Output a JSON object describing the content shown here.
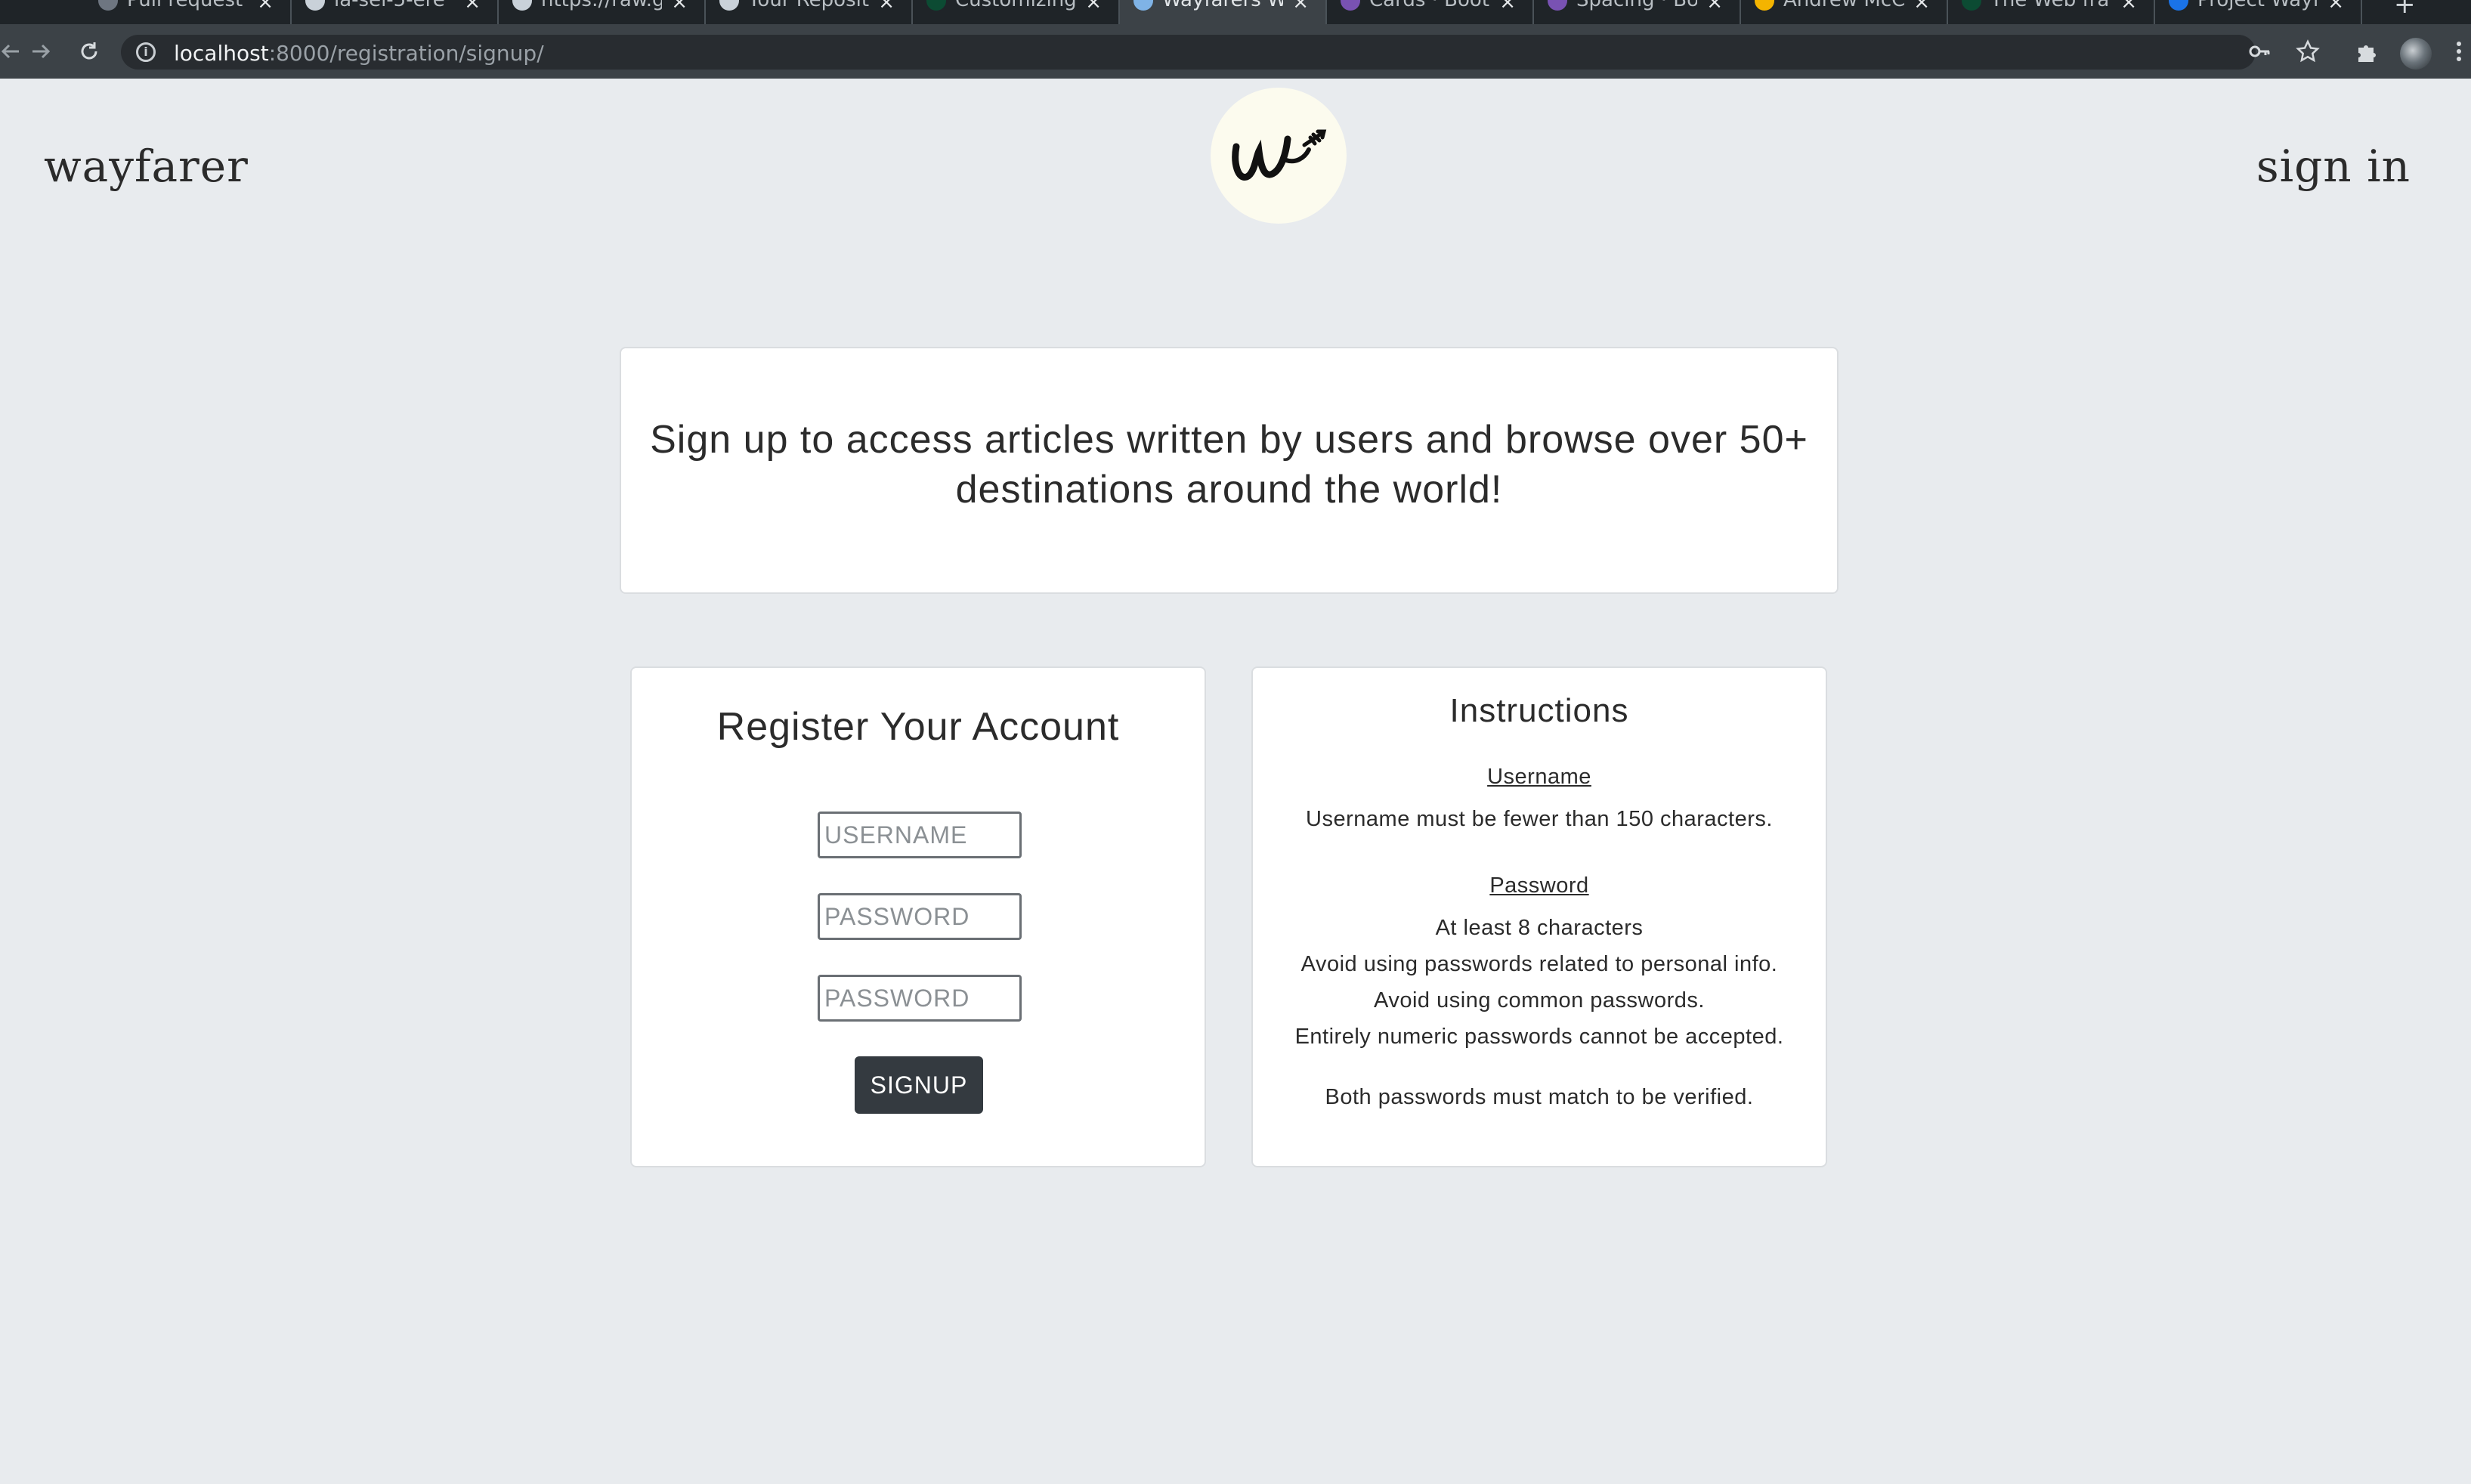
{
  "browser": {
    "tabs": [
      {
        "title": "Pull request",
        "favicon_color": "#6e7681"
      },
      {
        "title": "la-sei-5-ere",
        "favicon_color": "#c9d1d9"
      },
      {
        "title": "https://raw.g",
        "favicon_color": "#c9d1d9"
      },
      {
        "title": "Your Reposito",
        "favicon_color": "#c9d1d9"
      },
      {
        "title": "Customizing",
        "favicon_color": "#0c4b33"
      },
      {
        "title": "Wayfarers W",
        "favicon_color": "#7fb3e6"
      },
      {
        "title": "Cards · Boot",
        "favicon_color": "#7952b3"
      },
      {
        "title": "Spacing · Bo",
        "favicon_color": "#7952b3"
      },
      {
        "title": "Andrew McC",
        "favicon_color": "#f4b400"
      },
      {
        "title": "The Web fra",
        "favicon_color": "#0c4b33"
      },
      {
        "title": "Project Wayfa",
        "favicon_color": "#1a73e8"
      }
    ],
    "active_tab_index": 5,
    "close_glyph": "×",
    "new_tab_glyph": "+",
    "url_host": "localhost",
    "url_path": ":8000/registration/signup/",
    "icons": {
      "back": "back-arrow-icon",
      "forward": "forward-arrow-icon",
      "reload": "reload-icon",
      "site_info": "info-icon",
      "key": "key-icon",
      "bookmark": "star-icon",
      "extensions": "puzzle-icon",
      "menu": "kebab-menu-icon"
    }
  },
  "header": {
    "brand": "wayfarer",
    "signin_label": "sign in"
  },
  "intro": {
    "text": "Sign up to access articles written by users and browse over 50+ destinations around the world!"
  },
  "register": {
    "title": "Register Your Account",
    "username_placeholder": "USERNAME",
    "password_placeholder": "PASSWORD",
    "password_confirm_placeholder": "PASSWORD",
    "signup_label": "SIGNUP"
  },
  "instructions": {
    "title": "Instructions",
    "username_heading": "Username",
    "username_rule": "Username must be fewer than 150 characters.",
    "password_heading": "Password",
    "password_rules": [
      "At least 8 characters",
      "Avoid using passwords related to personal info.",
      "Avoid using common passwords.",
      "Entirely numeric passwords cannot be accepted."
    ],
    "match_note": "Both passwords must match to be verified."
  },
  "colors": {
    "page_background": "#e8ebee",
    "button": "#343a40",
    "logo_background": "#fcfbee"
  }
}
